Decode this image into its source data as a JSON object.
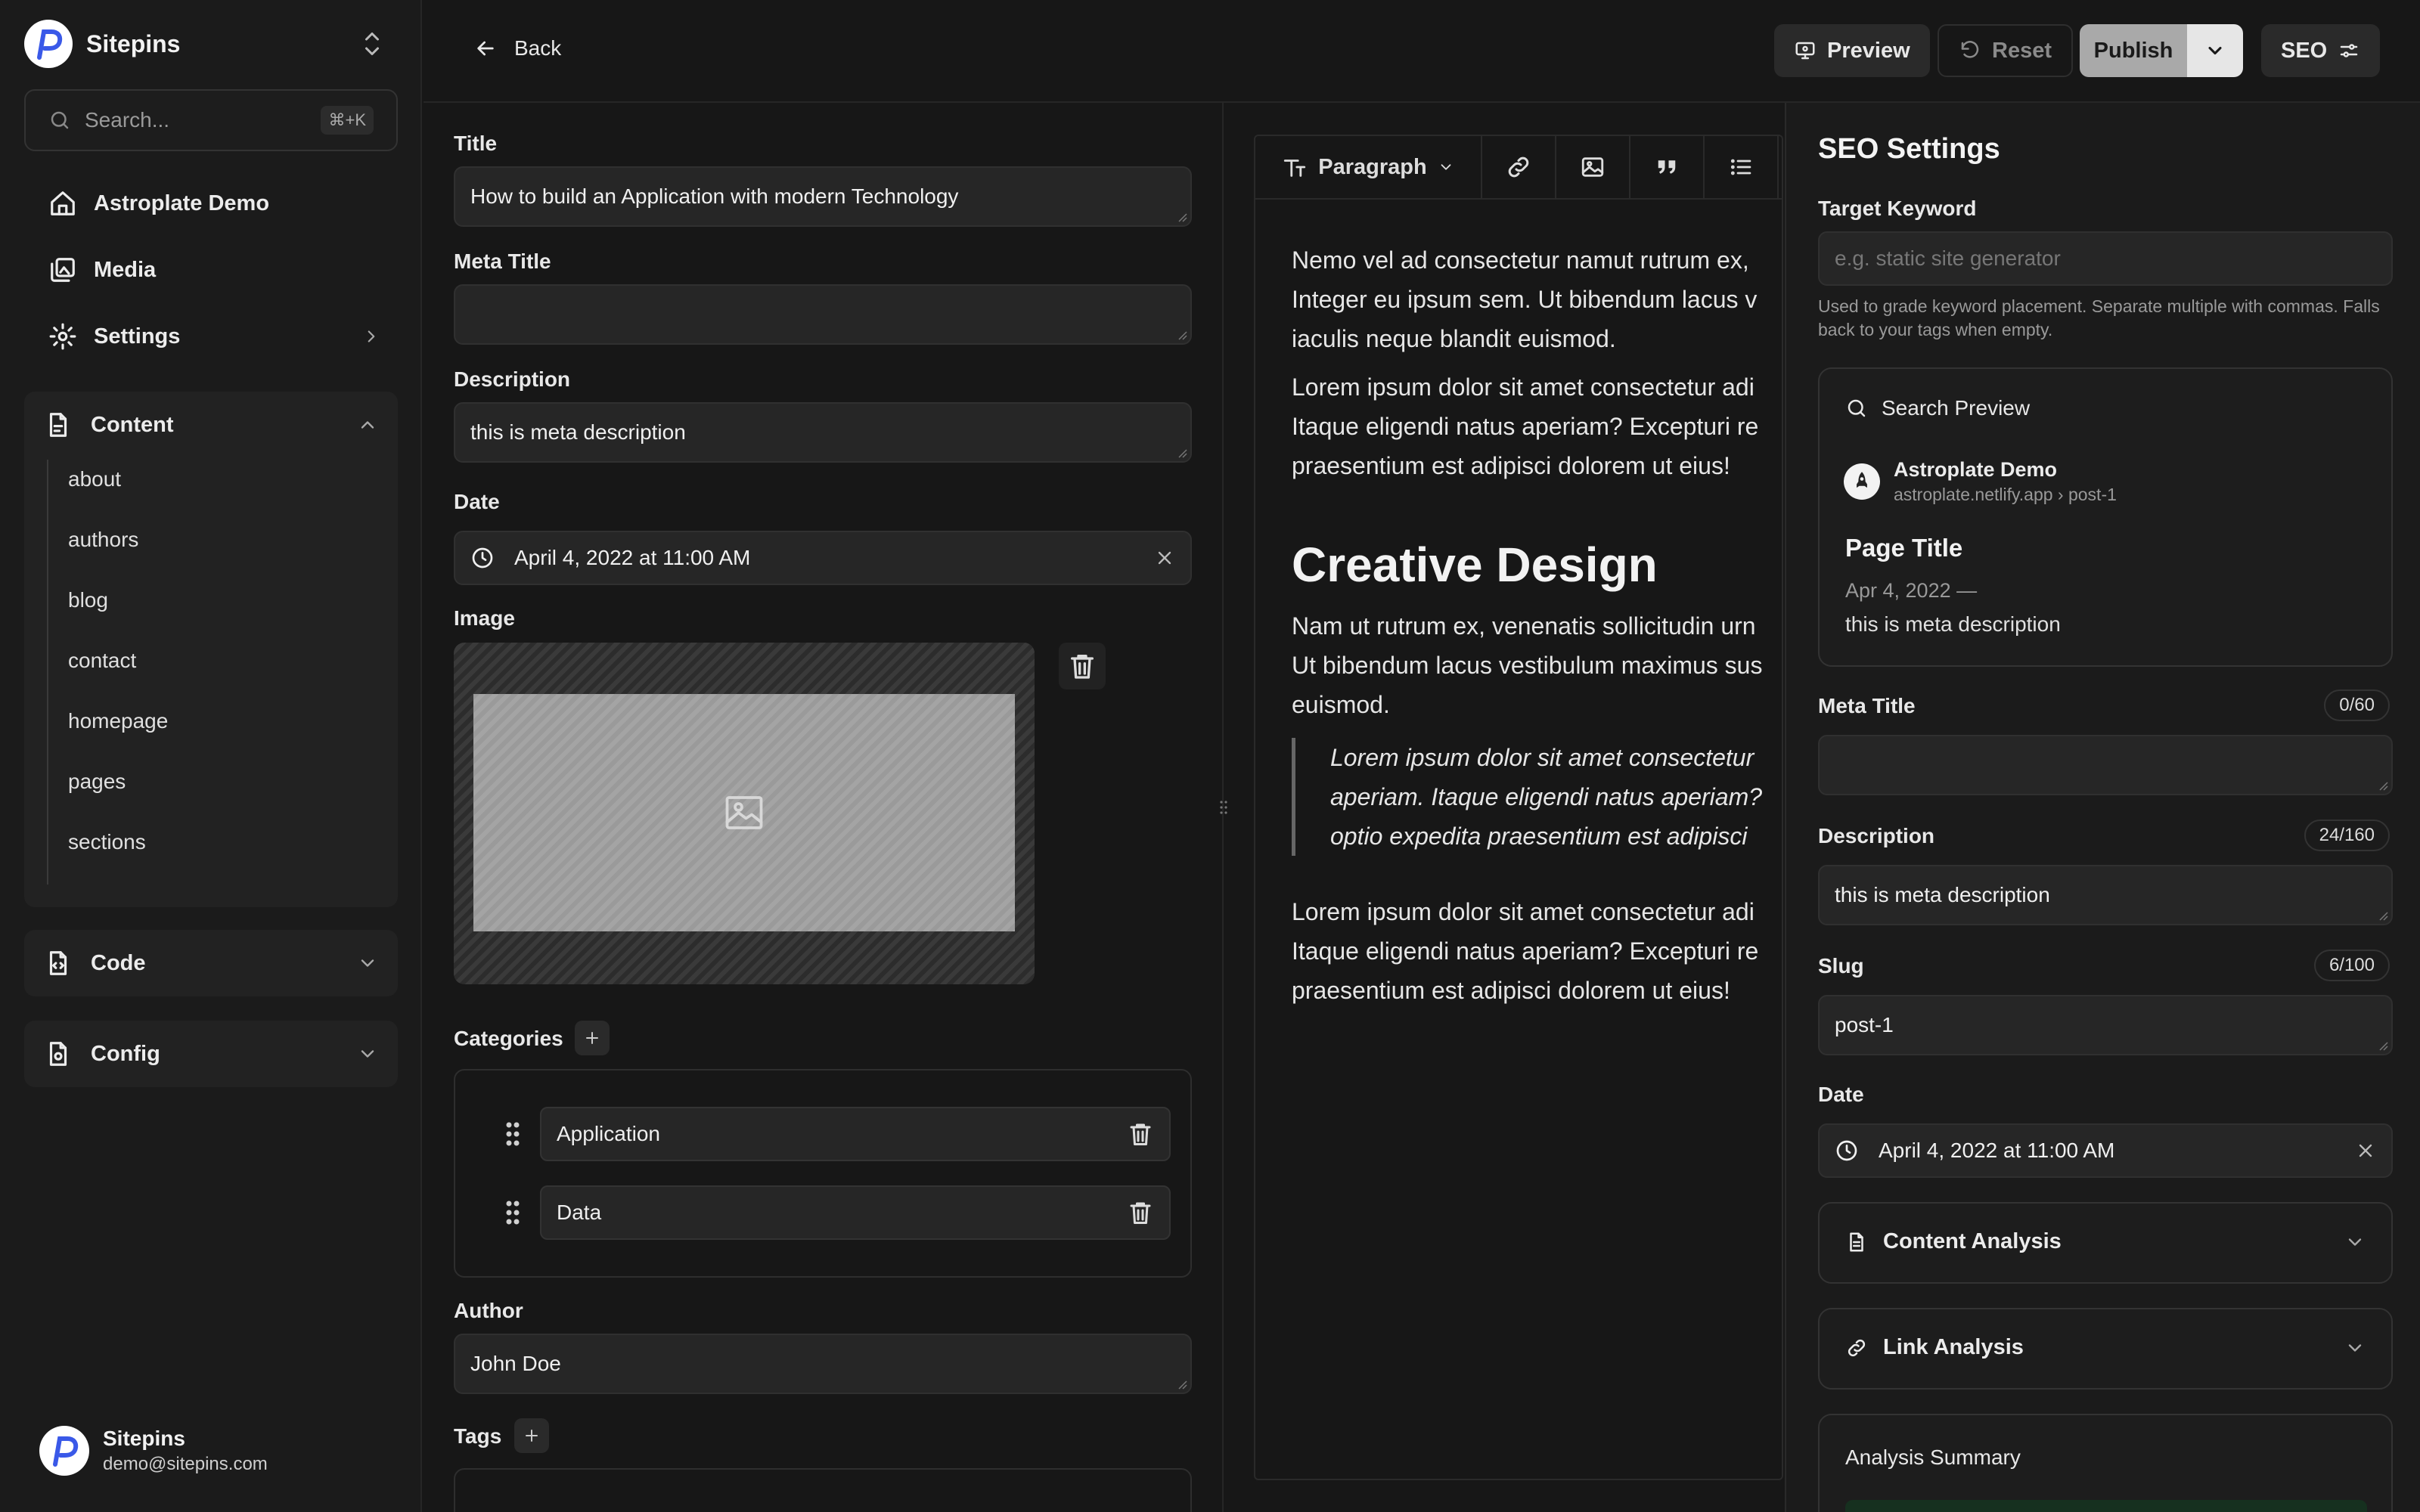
{
  "sidebar": {
    "brand": "Sitepins",
    "search_placeholder": "Search...",
    "search_shortcut": "⌘+K",
    "nav": [
      {
        "label": "Astroplate Demo",
        "icon": "home-icon"
      },
      {
        "label": "Media",
        "icon": "media-icon"
      },
      {
        "label": "Settings",
        "icon": "gear-icon"
      }
    ],
    "content_group": {
      "label": "Content",
      "items": [
        "about",
        "authors",
        "blog",
        "contact",
        "homepage",
        "pages",
        "sections"
      ]
    },
    "code_group": {
      "label": "Code"
    },
    "config_group": {
      "label": "Config"
    },
    "user": {
      "name": "Sitepins",
      "email": "demo@sitepins.com"
    }
  },
  "topbar": {
    "back_label": "Back",
    "preview_label": "Preview",
    "reset_label": "Reset",
    "publish_label": "Publish",
    "seo_label": "SEO"
  },
  "form": {
    "title_label": "Title",
    "title_value": "How to build an Application with modern Technology",
    "meta_title_label": "Meta Title",
    "meta_title_value": "",
    "description_label": "Description",
    "description_value": "this is meta description",
    "date_label": "Date",
    "date_value": "April 4, 2022 at 11:00 AM",
    "image_label": "Image",
    "categories_label": "Categories",
    "categories": [
      "Application",
      "Data"
    ],
    "author_label": "Author",
    "author_value": "John Doe",
    "tags_label": "Tags"
  },
  "editor": {
    "block_type": "Paragraph",
    "paragraphs": [
      [
        "Nemo vel ad consectetur namut rutrum ex,",
        "Integer eu ipsum sem. Ut bibendum lacus v",
        "iaculis neque blandit euismod."
      ],
      [
        "Lorem ipsum dolor sit amet consectetur adi",
        "Itaque eligendi natus aperiam? Excepturi re",
        "praesentium est adipisci dolorem ut eius!"
      ]
    ],
    "heading": "Creative Design",
    "paragraph3": [
      "Nam ut rutrum ex, venenatis sollicitudin urn",
      "Ut bibendum lacus vestibulum maximus sus",
      "euismod."
    ],
    "quote": [
      "Lorem ipsum dolor sit amet consectetur",
      "aperiam. Itaque eligendi natus aperiam?",
      "optio expedita praesentium est adipisci"
    ],
    "paragraph4": [
      "Lorem ipsum dolor sit amet consectetur adi",
      "Itaque eligendi natus aperiam? Excepturi re",
      "praesentium est adipisci dolorem ut eius!"
    ]
  },
  "seo": {
    "title": "SEO Settings",
    "target_keyword_label": "Target Keyword",
    "target_keyword_placeholder": "e.g. static site generator",
    "target_keyword_help": "Used to grade keyword placement. Separate multiple with commas. Falls back to your tags when empty.",
    "search_preview": {
      "label": "Search Preview",
      "site_name": "Astroplate Demo",
      "site_url": "astroplate.netlify.app › post-1",
      "page_title": "Page Title",
      "date": "Apr 4, 2022 —",
      "description": "this is meta description"
    },
    "meta_title_label": "Meta Title",
    "meta_title_count": "0/60",
    "meta_title_value": "",
    "description_label": "Description",
    "description_count": "24/160",
    "description_value": "this is meta description",
    "slug_label": "Slug",
    "slug_count": "6/100",
    "slug_value": "post-1",
    "date_label": "Date",
    "date_value": "April 4, 2022 at 11:00 AM",
    "content_analysis_label": "Content Analysis",
    "link_analysis_label": "Link Analysis",
    "analysis_summary_label": "Analysis Summary"
  }
}
